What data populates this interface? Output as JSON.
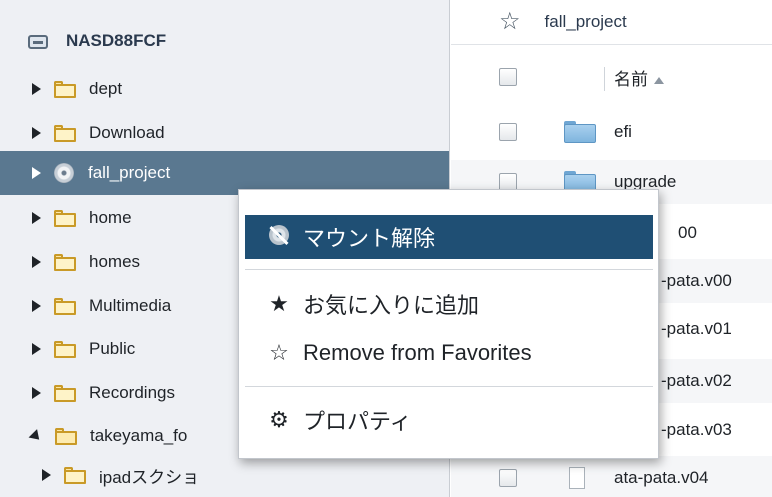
{
  "tree": {
    "root_label": "NASD88FCF",
    "items": [
      {
        "label": "dept",
        "icon": "folder-icon"
      },
      {
        "label": "Download",
        "icon": "folder-icon"
      },
      {
        "label": "fall_project",
        "icon": "disc-icon",
        "selected": true
      },
      {
        "label": "home",
        "icon": "folder-icon"
      },
      {
        "label": "homes",
        "icon": "folder-icon"
      },
      {
        "label": "Multimedia",
        "icon": "folder-icon"
      },
      {
        "label": "Public",
        "icon": "folder-icon"
      },
      {
        "label": "Recordings",
        "icon": "folder-icon"
      },
      {
        "label": "takeyama_fo",
        "icon": "folder-open-icon",
        "expanded": true
      },
      {
        "label": "ipadスクショ",
        "icon": "folder-icon",
        "child": true
      }
    ]
  },
  "list": {
    "location": "fall_project",
    "column_name": "名前",
    "rows": [
      {
        "name": "efi",
        "type": "folder"
      },
      {
        "name": "upgrade",
        "type": "folder"
      },
      {
        "name": "00",
        "type": "file"
      },
      {
        "name": "-pata.v00",
        "type": "file"
      },
      {
        "name": "-pata.v01",
        "type": "file"
      },
      {
        "name": "-pata.v02",
        "type": "file"
      },
      {
        "name": "-pata.v03",
        "type": "file"
      },
      {
        "name": "ata-pata.v04",
        "type": "file"
      }
    ]
  },
  "context_menu": {
    "items": [
      {
        "label": "マウント解除",
        "icon": "unmount-icon",
        "highlighted": true
      },
      {
        "label": "お気に入りに追加",
        "icon": "star-filled-icon"
      },
      {
        "label": "Remove from Favorites",
        "icon": "star-outline-icon"
      },
      {
        "label": "プロパティ",
        "icon": "gears-icon"
      }
    ]
  },
  "colors": {
    "selected_row": "#5a7890",
    "menu_highlight": "#1f4f74",
    "folder_yellow": "#fef3c8",
    "folder_blue": "#7fb5de"
  }
}
